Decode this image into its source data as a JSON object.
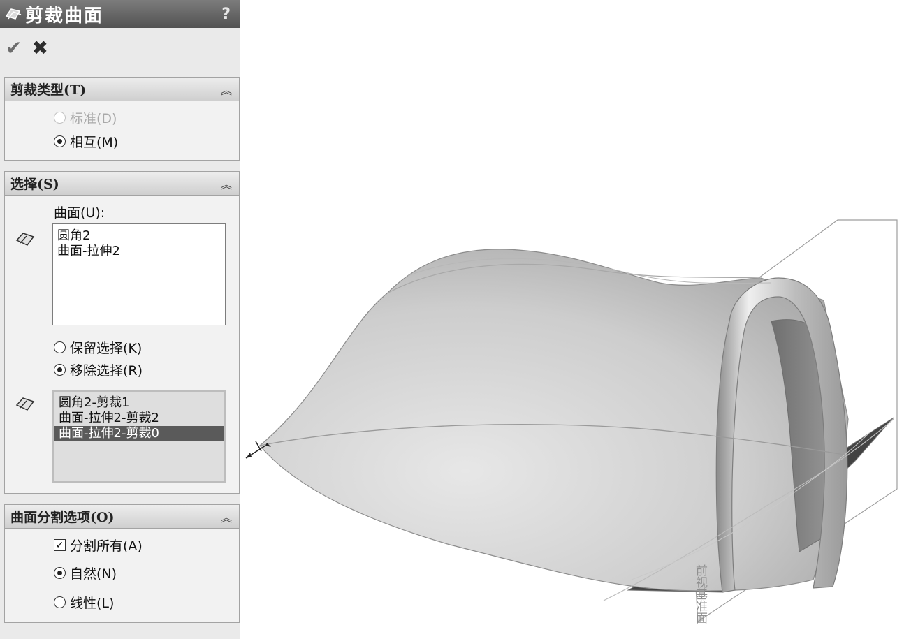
{
  "panel": {
    "title": "剪裁曲面",
    "help_label": "?",
    "icons": {
      "title": "trim-surface-icon",
      "ok": "check-icon",
      "cancel": "close-icon",
      "face": "face-select-icon"
    }
  },
  "actions": {
    "ok_symbol": "✔",
    "cancel_symbol": "✖"
  },
  "trim_type": {
    "header": "剪裁类型(T)",
    "collapse": "︽",
    "options": [
      {
        "label": "标准(D)",
        "selected": false,
        "enabled": false
      },
      {
        "label": "相互(M)",
        "selected": true,
        "enabled": true
      }
    ]
  },
  "selections": {
    "header": "选择(S)",
    "collapse": "︽",
    "surfaces_label": "曲面(U):",
    "surfaces": [
      "圆角2",
      "曲面-拉伸2"
    ],
    "mode_options": [
      {
        "label": "保留选择(K)",
        "selected": false
      },
      {
        "label": "移除选择(R)",
        "selected": true
      }
    ],
    "pieces": [
      "圆角2-剪裁1",
      "曲面-拉伸2-剪裁2",
      "曲面-拉伸2-剪裁0"
    ],
    "selected_piece": "曲面-拉伸2-剪裁0"
  },
  "split_options": {
    "header": "曲面分割选项(O)",
    "collapse": "︽",
    "split_all": {
      "label": "分割所有(A)",
      "checked": true
    },
    "options": [
      {
        "label": "自然(N)",
        "selected": true
      },
      {
        "label": "线性(L)",
        "selected": false
      }
    ]
  },
  "viewport": {
    "plane_text": "前视基准面",
    "colors": {
      "surface_light": "#ececec",
      "surface_mid": "#b9b9b9",
      "surface_dark": "#3c3c3c",
      "edge": "#7d7d7d"
    }
  }
}
